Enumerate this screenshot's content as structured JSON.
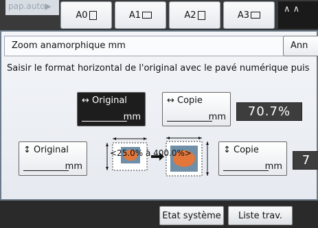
{
  "tabs": {
    "auto_label": "pap.auto▶",
    "items": [
      {
        "label": "A0",
        "icon": "portrait-page-icon"
      },
      {
        "label": "A1",
        "icon": "landscape-page-icon"
      },
      {
        "label": "A2",
        "icon": "portrait-page-icon"
      },
      {
        "label": "A3",
        "icon": "landscape-page-icon"
      }
    ],
    "dark_label": "∧ ∧"
  },
  "panel": {
    "title": "Zoom anamorphique mm",
    "cancel_label": "Ann",
    "instruction": "Saisir le format horizontal de l'original avec le pavé numérique puis"
  },
  "horizontal": {
    "original_label": "↔ Original",
    "original_unit": "mm",
    "copy_label": "↔ Copie",
    "copy_unit": "mm",
    "ratio": "70.7%"
  },
  "vertical": {
    "original_label": "↕ Original",
    "original_unit": "mm",
    "copy_label": "↕ Copie",
    "copy_unit": "mm",
    "ratio": "7"
  },
  "range_text": "<25.0% à 400.0%>",
  "bottom": {
    "status_label": "Etat système",
    "jobs_label": "Liste trav."
  },
  "colors": {
    "selected_button": "#1d1d1d",
    "display_bg": "#3d3d3d",
    "panel_border": "#6b7a8a"
  }
}
